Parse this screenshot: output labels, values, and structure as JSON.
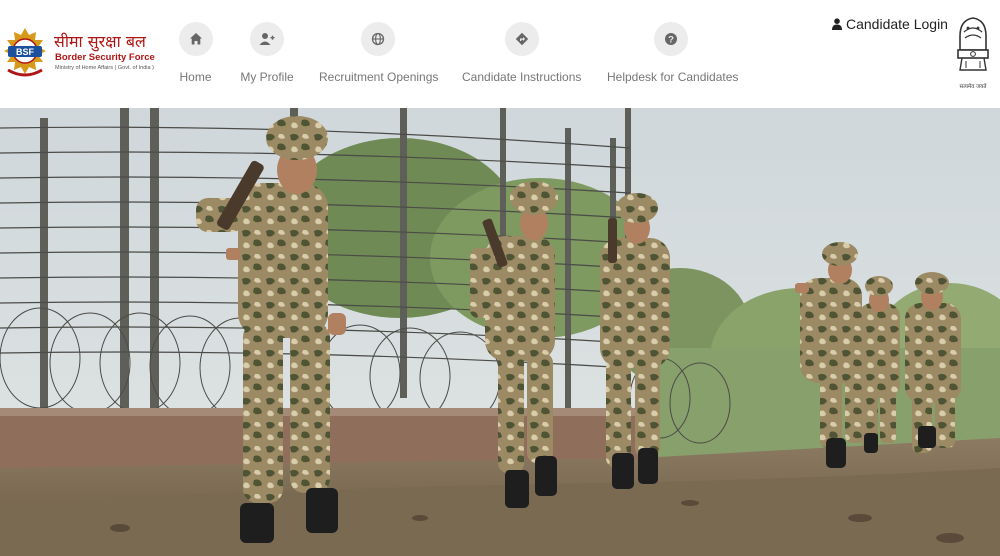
{
  "brand": {
    "badge": "BSF",
    "hindi_name": "सीमा सुरक्षा बल",
    "english_name": "Border Security Force",
    "ministry": "Ministry of Home Affairs ( Govt. of India )",
    "colors": {
      "red": "#b01515",
      "gold": "#d59a1a"
    }
  },
  "nav": {
    "items": [
      {
        "label": "Home",
        "icon": "home-icon"
      },
      {
        "label": "My Profile",
        "icon": "user-plus-icon"
      },
      {
        "label": "Recruitment Openings",
        "icon": "globe-icon"
      },
      {
        "label": "Candidate Instructions",
        "icon": "directions-icon"
      },
      {
        "label": "Helpdesk for Candidates",
        "icon": "question-icon"
      }
    ]
  },
  "login": {
    "label": "Candidate Login",
    "icon": "user-icon"
  },
  "emblem": {
    "caption": "सत्यमेव जयते"
  },
  "hero": {
    "description_icon": "hero-banner-image"
  }
}
